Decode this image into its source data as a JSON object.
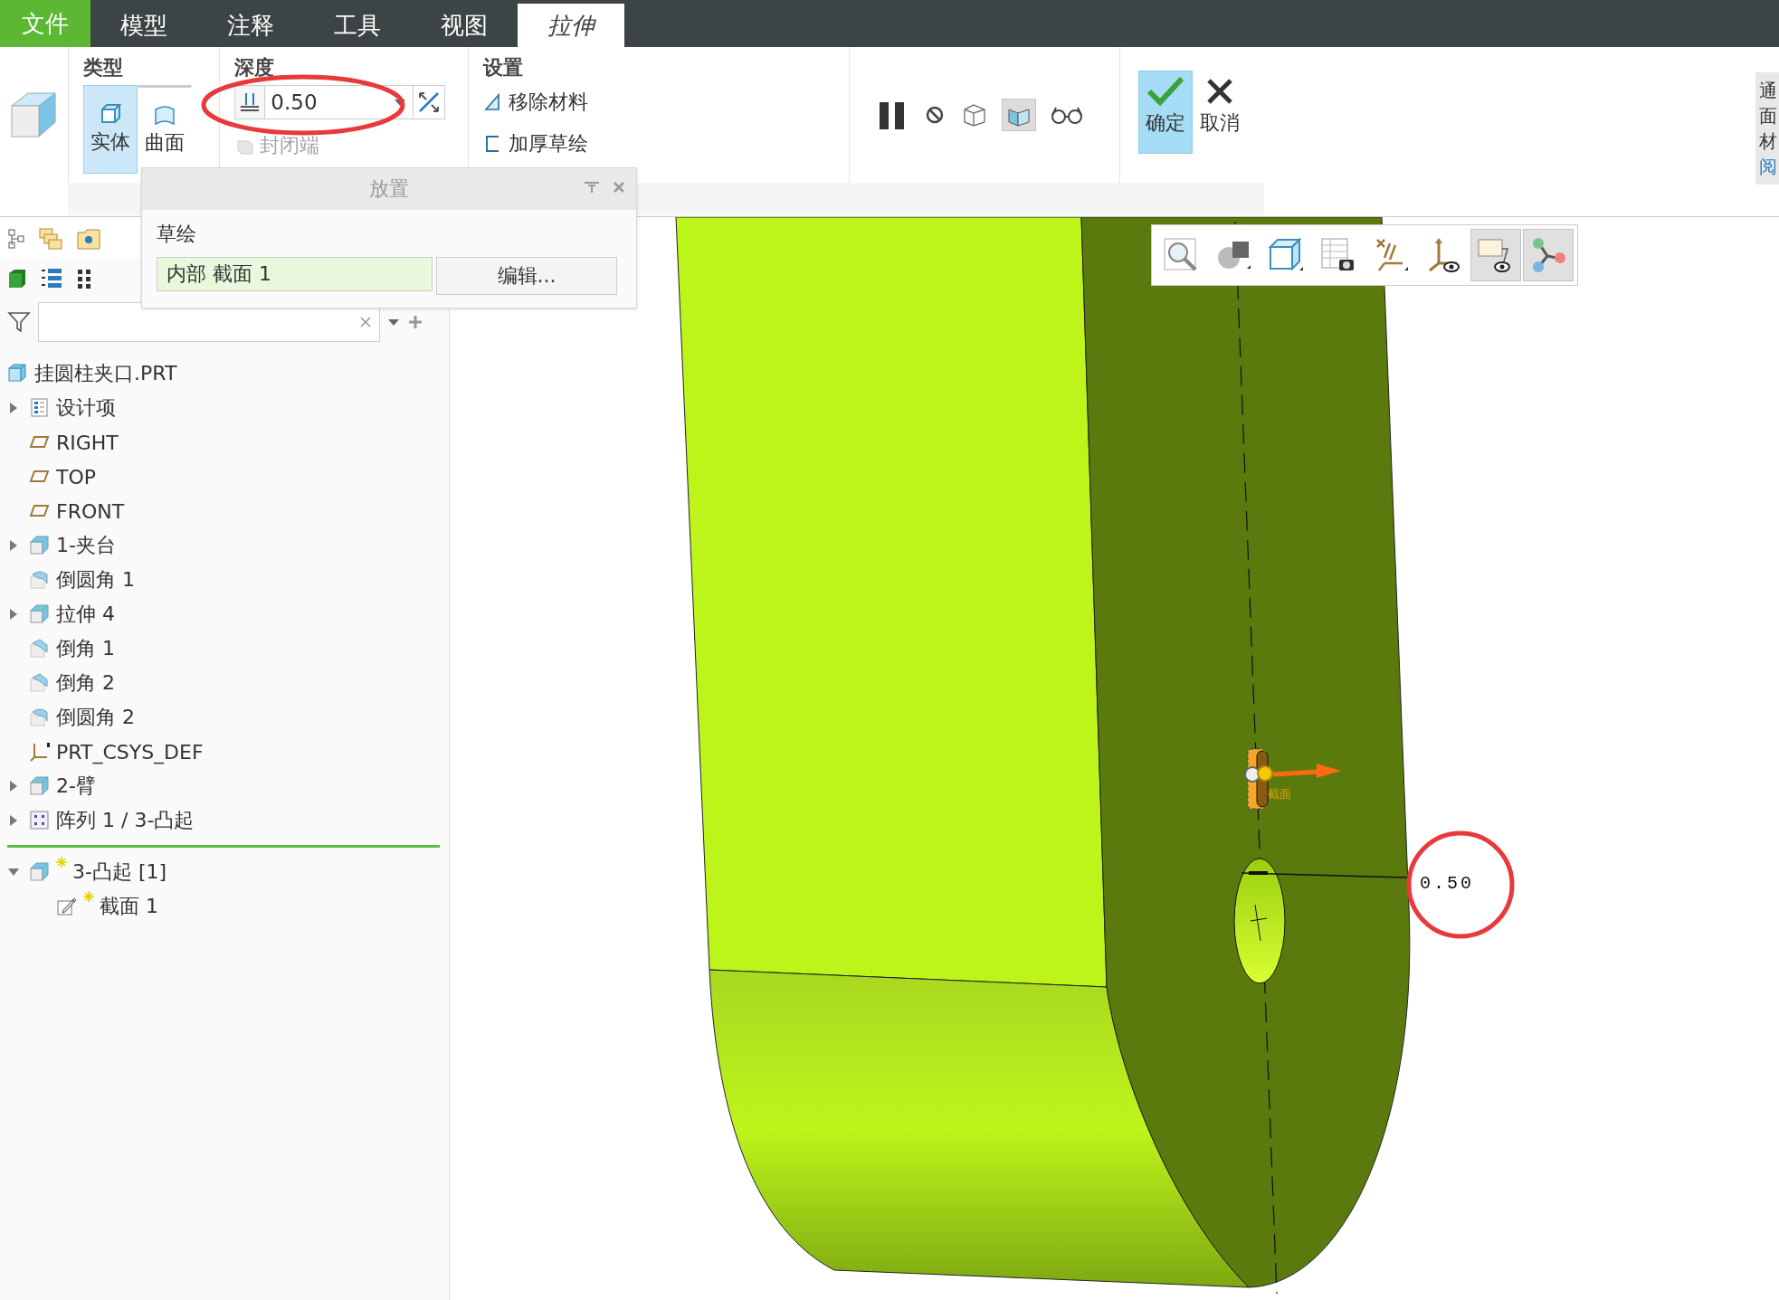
{
  "menu_tabs": [
    {
      "label": "文件",
      "kind": "file",
      "selected": false
    },
    {
      "label": "模型",
      "kind": "tab",
      "selected": false
    },
    {
      "label": "注释",
      "kind": "tab",
      "selected": false
    },
    {
      "label": "工具",
      "kind": "tab",
      "selected": false
    },
    {
      "label": "视图",
      "kind": "tab",
      "selected": false
    },
    {
      "label": "拉伸",
      "kind": "tab",
      "selected": true
    }
  ],
  "ribbon": {
    "type_group": {
      "title": "类型",
      "options": [
        {
          "label": "实体",
          "kind": "solid",
          "selected": true
        },
        {
          "label": "曲面",
          "kind": "surface",
          "selected": false
        }
      ]
    },
    "depth_group": {
      "title": "深度",
      "value": "0.50",
      "capped_ends": {
        "label": "封闭端",
        "disabled": true
      }
    },
    "settings_group": {
      "title": "设置",
      "options": [
        {
          "label": "移除材料",
          "kind": "remove"
        },
        {
          "label": "加厚草绘",
          "kind": "thicken"
        }
      ]
    },
    "preview_tools": [
      {
        "kind": "pause",
        "selected": false
      },
      {
        "kind": "no-preview",
        "selected": false
      },
      {
        "kind": "wireframe",
        "selected": false
      },
      {
        "kind": "shaded",
        "selected": true
      },
      {
        "kind": "glasses",
        "selected": false
      }
    ],
    "confirm": {
      "label": "确定"
    },
    "cancel": {
      "label": "取消"
    }
  },
  "side_note": {
    "lines": [
      "通",
      "面",
      "材"
    ],
    "link": "阅"
  },
  "placement_panel": {
    "title": "放置",
    "section_label": "草绘",
    "sketch_value": "内部 截面 1",
    "edit_button": "编辑..."
  },
  "model_tree": {
    "items": [
      {
        "label": "挂圆柱夹口.PRT",
        "kind": "part",
        "children": [
          {
            "label": "设计项",
            "kind": "design",
            "expanded": false
          },
          {
            "label": "RIGHT",
            "kind": "plane"
          },
          {
            "label": "TOP",
            "kind": "plane"
          },
          {
            "label": "FRONT",
            "kind": "plane"
          },
          {
            "label": "1-夹台",
            "kind": "feature",
            "expanded": false
          },
          {
            "label": "倒圆角 1",
            "kind": "round"
          },
          {
            "label": "拉伸 4",
            "kind": "feature",
            "expanded": false
          },
          {
            "label": "倒角 1",
            "kind": "chamfer"
          },
          {
            "label": "倒角 2",
            "kind": "chamfer"
          },
          {
            "label": "倒圆角 2",
            "kind": "round"
          },
          {
            "label": "PRT_CSYS_DEF",
            "kind": "csys"
          },
          {
            "label": "2-臂",
            "kind": "feature",
            "expanded": false
          },
          {
            "label": "阵列 1 / 3-凸起",
            "kind": "pattern",
            "expanded": false,
            "insert_after": true
          },
          {
            "label": "3-凸起 [1]",
            "kind": "feature",
            "expanded": true,
            "modified": true,
            "children": [
              {
                "label": "截面 1",
                "kind": "sketch",
                "modified": true
              }
            ]
          }
        ]
      }
    ]
  },
  "viewport": {
    "dimension": "0.50",
    "section_label": "截面",
    "view_tools": [
      {
        "kind": "refit",
        "selected": false
      },
      {
        "kind": "display-style",
        "selected": false
      },
      {
        "kind": "saved-views",
        "selected": false
      },
      {
        "kind": "view-manager",
        "selected": false
      },
      {
        "kind": "datum-display",
        "selected": false
      },
      {
        "kind": "csys-display",
        "selected": false
      },
      {
        "kind": "annotation-display",
        "selected": true
      },
      {
        "kind": "spin-center",
        "selected": true
      }
    ]
  }
}
